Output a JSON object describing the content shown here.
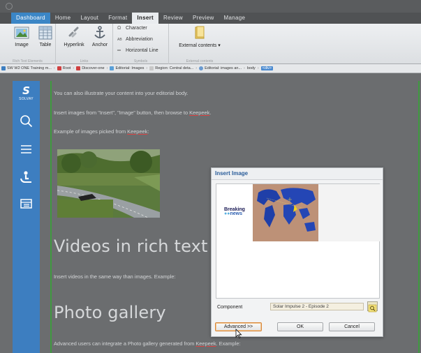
{
  "tabs": [
    {
      "label": "Dashboard",
      "style": "blue"
    },
    {
      "label": "Home",
      "style": ""
    },
    {
      "label": "Layout",
      "style": ""
    },
    {
      "label": "Format",
      "style": ""
    },
    {
      "label": "Insert",
      "style": "active"
    },
    {
      "label": "Review",
      "style": ""
    },
    {
      "label": "Preview",
      "style": ""
    },
    {
      "label": "Manage",
      "style": ""
    }
  ],
  "ribbon": {
    "image_label": "Image",
    "table_label": "Table",
    "hyperlink_label": "Hyperlink",
    "anchor_label": "Anchor",
    "character_label": "Character",
    "abbreviation_label": "Abbreviation",
    "horizontal_line_label": "Horizontal Line",
    "external_contents_label": "External contents ▾",
    "group_rich_text": "Rich Text Elements",
    "group_links": "Links",
    "group_symbols": "Symbols",
    "group_external": "External contents"
  },
  "breadcrumbs": [
    {
      "label": "SW W2 ONE Training m...",
      "color": "#3d7ec0"
    },
    {
      "label": "Root",
      "color": "#d04040"
    },
    {
      "label": "Discover-one",
      "color": "#d04040"
    },
    {
      "label": "Editorial: Images",
      "color": "#5aa0d8"
    },
    {
      "label": "Region: Central deta...",
      "color": "#c8c8c8"
    },
    {
      "label": "Editorial: images an...",
      "color": "#6a9ad0"
    },
    {
      "label": "body",
      "color": ""
    },
    {
      "label": "<div>",
      "color": "",
      "selected": true
    }
  ],
  "sidebar": {
    "logo_letter": "S",
    "logo_text": "SOLVAY"
  },
  "content": {
    "p1": "You can also illustrate your content into your editorial body.",
    "p2_before": "Insert images from \"Insert\", \"Image\" button, then browse to ",
    "p2_link": "Keepeek",
    "p2_after": ".",
    "p3_before": "Example of images picked from ",
    "p3_link": "Keepeek",
    "p3_after": ":",
    "h_videos": "Videos in rich text",
    "p4": "Insert videos in the same way than images. Example:",
    "h_gallery": "Photo gallery",
    "p5_before": "Advanced users can integrate a Photo gallery generated from ",
    "p5_link": "Keepeek",
    "p5_after": ". Example:"
  },
  "dialog": {
    "title": "Insert Image",
    "thumb_text_line1": "Breaking",
    "thumb_text_line2": "news",
    "component_label": "Component",
    "component_value": "Solar Impulse 2 - Episode 2",
    "advanced_label": "Advanced >>",
    "ok_label": "OK",
    "cancel_label": "Cancel"
  }
}
